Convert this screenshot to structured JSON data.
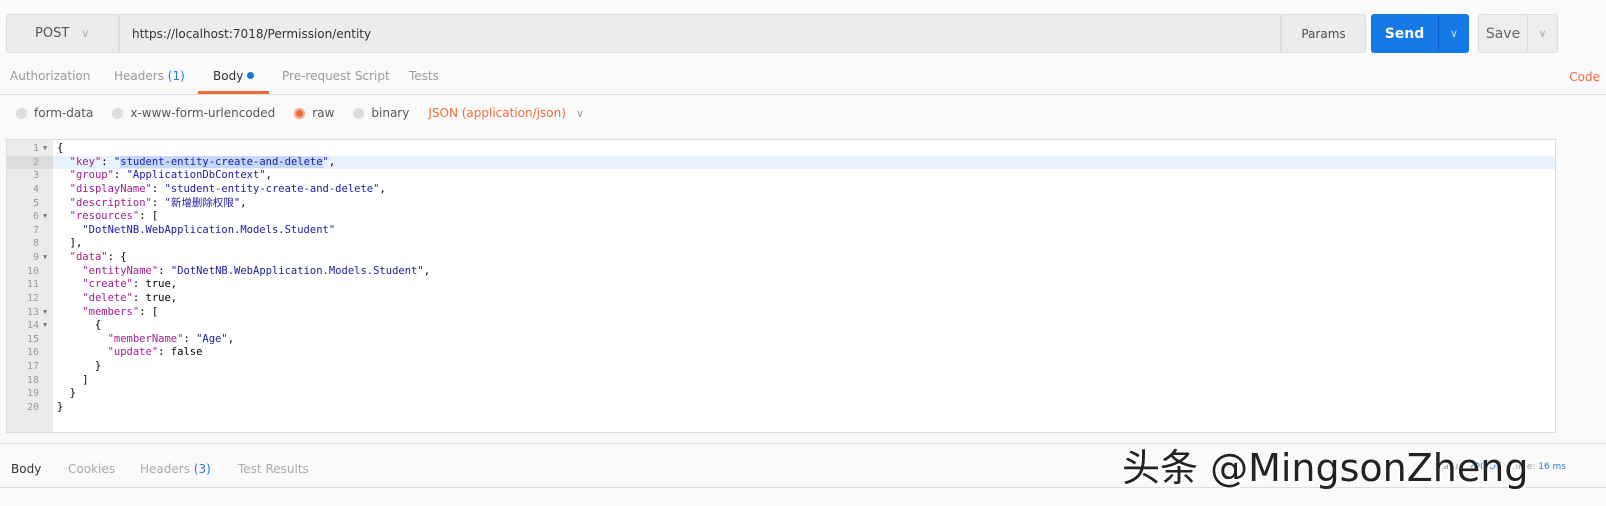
{
  "request": {
    "method": "POST",
    "url": "https://localhost:7018/Permission/entity",
    "params_label": "Params",
    "send_label": "Send",
    "save_label": "Save"
  },
  "tabs": [
    {
      "label": "Authorization"
    },
    {
      "label": "Headers",
      "count": "(1)"
    },
    {
      "label": "Body",
      "active": true
    },
    {
      "label": "Pre-request Script"
    },
    {
      "label": "Tests"
    }
  ],
  "code_link": "Code",
  "body_modes": [
    {
      "label": "form-data"
    },
    {
      "label": "x-www-form-urlencoded"
    },
    {
      "label": "raw",
      "selected": true
    },
    {
      "label": "binary"
    }
  ],
  "content_type": "JSON (application/json)",
  "editor": {
    "highlighted_line": 2,
    "lines": [
      [
        [
          "p",
          "{"
        ]
      ],
      [
        [
          "p",
          "  "
        ],
        [
          "k",
          "\"key\""
        ],
        [
          "p",
          ": "
        ],
        [
          "s",
          "\""
        ],
        [
          "sel",
          "student-entity-create-and-delete"
        ],
        [
          "s",
          "\""
        ],
        [
          "p",
          ","
        ]
      ],
      [
        [
          "p",
          "  "
        ],
        [
          "k",
          "\"group\""
        ],
        [
          "p",
          ": "
        ],
        [
          "s",
          "\"ApplicationDbContext\""
        ],
        [
          "p",
          ","
        ]
      ],
      [
        [
          "p",
          "  "
        ],
        [
          "k",
          "\"displayName\""
        ],
        [
          "p",
          ": "
        ],
        [
          "s",
          "\"student-entity-create-and-delete\""
        ],
        [
          "p",
          ","
        ]
      ],
      [
        [
          "p",
          "  "
        ],
        [
          "k",
          "\"description\""
        ],
        [
          "p",
          ": "
        ],
        [
          "s",
          "\"新增删除权限\""
        ],
        [
          "p",
          ","
        ]
      ],
      [
        [
          "p",
          "  "
        ],
        [
          "k",
          "\"resources\""
        ],
        [
          "p",
          ": ["
        ]
      ],
      [
        [
          "p",
          "    "
        ],
        [
          "s",
          "\"DotNetNB.WebApplication.Models.Student\""
        ]
      ],
      [
        [
          "p",
          "  ],"
        ]
      ],
      [
        [
          "p",
          "  "
        ],
        [
          "k",
          "\"data\""
        ],
        [
          "p",
          ": {"
        ]
      ],
      [
        [
          "p",
          "    "
        ],
        [
          "k",
          "\"entityName\""
        ],
        [
          "p",
          ": "
        ],
        [
          "s",
          "\"DotNetNB.WebApplication.Models.Student\""
        ],
        [
          "p",
          ","
        ]
      ],
      [
        [
          "p",
          "    "
        ],
        [
          "k",
          "\"create\""
        ],
        [
          "p",
          ": true,"
        ]
      ],
      [
        [
          "p",
          "    "
        ],
        [
          "k",
          "\"delete\""
        ],
        [
          "p",
          ": true,"
        ]
      ],
      [
        [
          "p",
          "    "
        ],
        [
          "k",
          "\"members\""
        ],
        [
          "p",
          ": ["
        ]
      ],
      [
        [
          "p",
          "      {"
        ]
      ],
      [
        [
          "p",
          "        "
        ],
        [
          "k",
          "\"memberName\""
        ],
        [
          "p",
          ": "
        ],
        [
          "s",
          "\"Age\""
        ],
        [
          "p",
          ","
        ]
      ],
      [
        [
          "p",
          "        "
        ],
        [
          "k",
          "\"update\""
        ],
        [
          "p",
          ": false"
        ]
      ],
      [
        [
          "p",
          "      }"
        ]
      ],
      [
        [
          "p",
          "    ]"
        ]
      ],
      [
        [
          "p",
          "  }"
        ]
      ],
      [
        [
          "p",
          "}"
        ]
      ]
    ],
    "foldable": [
      1,
      6,
      9,
      13,
      14
    ]
  },
  "response": {
    "tabs": [
      {
        "label": "Body",
        "active": true
      },
      {
        "label": "Cookies"
      },
      {
        "label": "Headers",
        "count": "(3)"
      },
      {
        "label": "Test Results"
      }
    ],
    "status_label": "Status:",
    "status_value": "200 OK",
    "time_label": "Time:",
    "time_value": "16 ms"
  },
  "watermark": "头条 @MingsonZheng",
  "colors": {
    "accent": "#f26b3a",
    "send": "#1579e6",
    "key": "#a11c8c",
    "string": "#1a1aa6"
  }
}
